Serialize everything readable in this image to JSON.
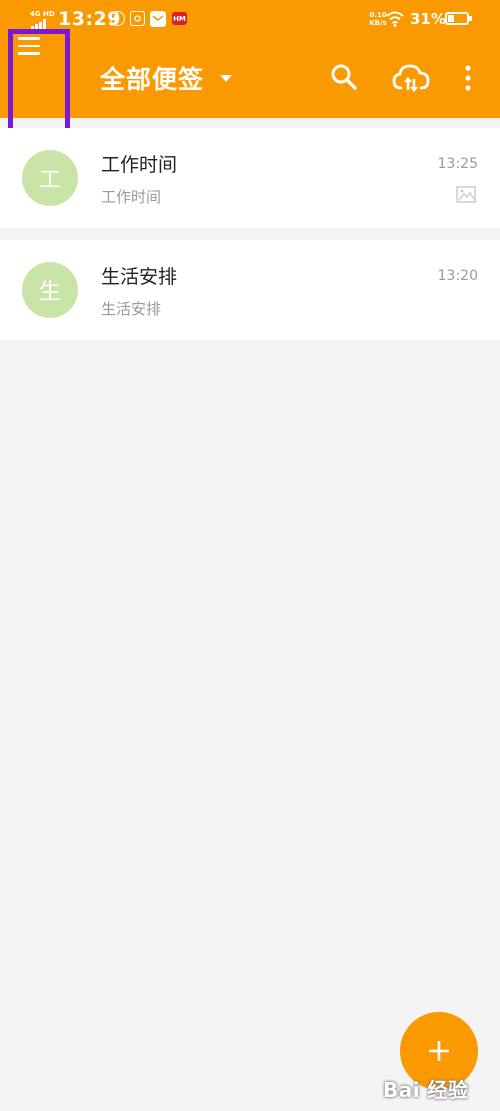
{
  "status_bar": {
    "network": "4G HD",
    "time": "13:29",
    "speed": "0.10 KB/s",
    "battery_percent": "31%",
    "battery_level": 0.31,
    "notification_icons": [
      "accessibility-icon",
      "app-icon",
      "mail-icon",
      "red-app-icon"
    ],
    "red_app_label": "HM"
  },
  "header": {
    "title": "全部便签",
    "background_color": "#fb9a00",
    "icons": [
      "menu-icon",
      "search-icon",
      "cloud-sync-icon",
      "more-vertical-icon"
    ]
  },
  "notes": [
    {
      "avatar_letter": "工",
      "title": "工作时间",
      "time": "13:25",
      "preview": "工作时间",
      "has_image": true
    },
    {
      "avatar_letter": "生",
      "title": "生活安排",
      "time": "13:20",
      "preview": "生活安排",
      "has_image": false
    }
  ],
  "fab": {
    "icon": "plus-icon"
  },
  "watermark": "Bai 经验",
  "highlight_color": "#7a18d6"
}
